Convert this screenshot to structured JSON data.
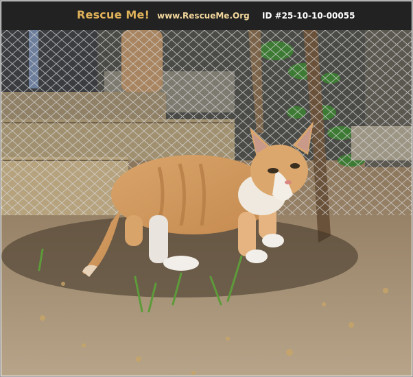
{
  "header": {
    "brand": "Rescue Me!",
    "url": "www.RescueMe.Org",
    "id_label": "ID #25-10-10-00055"
  },
  "photo": {
    "subject": "cat-photo"
  },
  "colors": {
    "header_bg": "#222222",
    "brand": "#e0b25a",
    "url": "#f2d79c",
    "id": "#ffffff"
  }
}
